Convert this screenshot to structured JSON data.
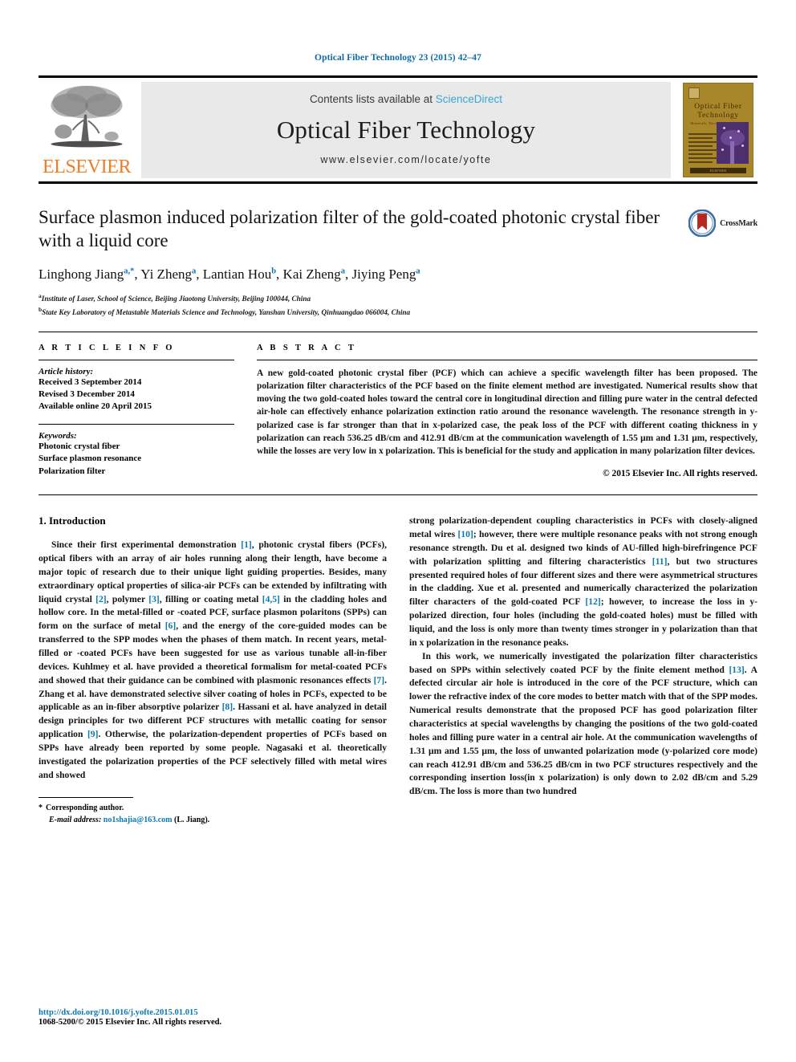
{
  "running_head": "Optical Fiber Technology 23 (2015) 42–47",
  "masthead": {
    "elsevier_word": "ELSEVIER",
    "contents_prefix": "Contents lists available at ",
    "sciencedirect": "ScienceDirect",
    "journal_name": "Optical Fiber Technology",
    "journal_url": "www.elsevier.com/locate/yofte",
    "cover": {
      "line1": "Optical  Fiber",
      "line2": "Technology",
      "subtitle": "Materials, Devices, and Systems",
      "footer": "ELSEVIER"
    }
  },
  "article": {
    "title": "Surface plasmon induced polarization filter of the gold-coated photonic crystal fiber with a liquid core",
    "crossmark_label": "CrossMark",
    "authors_html": "Linghong Jiang<sup>a,*</sup>, Yi Zheng<sup>a</sup>, Lantian Hou<sup>b</sup>, Kai Zheng<sup>a</sup>, Jiying Peng<sup>a</sup>",
    "affiliations": [
      {
        "mark": "a",
        "text": "Institute of Laser, School of Science, Beijing Jiaotong University, Beijing 100044, China"
      },
      {
        "mark": "b",
        "text": "State Key Laboratory of Metastable Materials Science and Technology, Yanshan University, Qinhuangdao 066004, China"
      }
    ]
  },
  "info": {
    "heading": "A R T I C L E    I N F O",
    "history_label": "Article history:",
    "history": [
      "Received 3 September 2014",
      "Revised 3 December 2014",
      "Available online 20 April 2015"
    ],
    "keywords_label": "Keywords:",
    "keywords": [
      "Photonic crystal fiber",
      "Surface plasmon resonance",
      "Polarization filter"
    ]
  },
  "abstract": {
    "heading": "A B S T R A C T",
    "text": "A new gold-coated photonic crystal fiber (PCF) which can achieve a specific wavelength filter has been proposed. The polarization filter characteristics of the PCF based on the finite element method are investigated. Numerical results show that moving the two gold-coated holes toward the central core in longitudinal direction and filling pure water in the central defected air-hole can effectively enhance polarization extinction ratio around the resonance wavelength. The resonance strength in y-polarized case is far stronger than that in x-polarized case, the peak loss of the PCF with different coating thickness in y polarization can reach 536.25 dB/cm and 412.91 dB/cm at the communication wavelength of 1.55 μm and 1.31 μm, respectively, while the losses are very low in x polarization. This is beneficial for the study and application in many polarization filter devices.",
    "copyright": "© 2015 Elsevier Inc. All rights reserved."
  },
  "body": {
    "section_title": "1. Introduction",
    "left_paragraphs": [
      "Since their first experimental demonstration [1], photonic crystal fibers (PCFs), optical fibers with an array of air holes running along their length, have become a major topic of research due to their unique light guiding properties. Besides, many extraordinary optical properties of silica-air PCFs can be extended by infiltrating with liquid crystal [2], polymer [3], filling or coating metal [4,5] in the cladding holes and hollow core. In the metal-filled or -coated PCF, surface plasmon polaritons (SPPs) can form on the surface of metal [6], and the energy of the core-guided modes can be transferred to the SPP modes when the phases of them match. In recent years, metal-filled or -coated PCFs have been suggested for use as various tunable all-in-fiber devices. Kuhlmey et al. have provided a theoretical formalism for metal-coated PCFs and showed that their guidance can be combined with plasmonic resonances effects [7]. Zhang et al. have demonstrated selective silver coating of holes in PCFs, expected to be applicable as an in-fiber absorptive polarizer [8]. Hassani et al. have analyzed in detail design principles for two different PCF structures with metallic coating for sensor application [9]. Otherwise, the polarization-dependent properties of PCFs based on SPPs have already been reported by some people. Nagasaki et al. theoretically investigated the polarization properties of the PCF selectively filled with metal wires and showed"
    ],
    "right_paragraphs": [
      "strong polarization-dependent coupling characteristics in PCFs with closely-aligned metal wires [10]; however, there were multiple resonance peaks with not strong enough resonance strength. Du et al. designed two kinds of AU-filled high-birefringence PCF with polarization splitting and filtering characteristics [11], but two structures presented required holes of four different sizes and there were asymmetrical structures in the cladding. Xue et al. presented and numerically characterized the polarization filter characters of the gold-coated PCF [12]; however, to increase the loss in y-polarized direction, four holes (including the gold-coated holes) must be filled with liquid, and the loss is only more than twenty times stronger in y polarization than that in x polarization in the resonance peaks.",
      "In this work, we numerically investigated the polarization filter characteristics based on SPPs within selectively coated PCF by the finite element method [13]. A defected circular air hole is introduced in the core of the PCF structure, which can lower the refractive index of the core modes to better match with that of the SPP modes. Numerical results demonstrate that the proposed PCF has good polarization filter characteristics at special wavelengths by changing the positions of the two gold-coated holes and filling pure water in a central air hole. At the communication wavelengths of 1.31 μm and 1.55 μm, the loss of unwanted polarization mode (y-polarized core mode) can reach 412.91 dB/cm and 536.25 dB/cm in two PCF structures respectively and the corresponding insertion loss(in x polarization) is only down to 2.02 dB/cm and 5.29 dB/cm. The loss is more than two hundred"
    ]
  },
  "footnote": {
    "corresponding": "Corresponding author.",
    "email_label": "E-mail address:",
    "email": "no1shajia@163.com",
    "email_owner": "(L. Jiang)."
  },
  "footer": {
    "doi": "http://dx.doi.org/10.1016/j.yofte.2015.01.015",
    "issn_line": "1068-5200/© 2015 Elsevier Inc. All rights reserved."
  },
  "colors": {
    "link_blue": "#0b78b0",
    "sciencedirect_blue": "#3ba5d1",
    "elsevier_orange": "#f07c24",
    "cover_gold": "#a8862a"
  }
}
